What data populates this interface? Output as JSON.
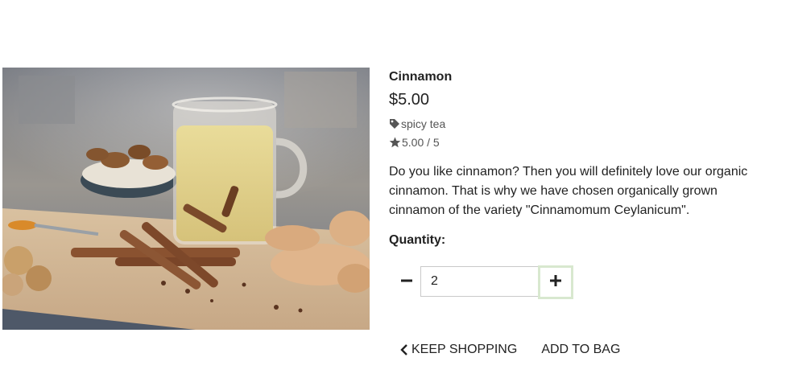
{
  "product": {
    "name": "Cinnamon",
    "price": "$5.00",
    "category": "spicy tea",
    "rating": "5.00 / 5",
    "description": "Do you like cinnamon? Then you will definitely love our organic cinnamon. That is why we have chosen organically grown cinnamon of the variety \"Cinnamomum Ceylanicum\".",
    "image_icon": "cup-of-tea-with-cinnamon-and-ginger-photo"
  },
  "quantity": {
    "label": "Quantity:",
    "value": "2",
    "decrement_icon": "minus-icon",
    "increment_icon": "plus-icon"
  },
  "actions": {
    "keep_shopping": "Keep Shopping",
    "add_to_bag": "Add to Bag"
  },
  "icons": {
    "category": "tag-icon",
    "rating": "star-icon",
    "back": "chevron-left-icon"
  },
  "colors": {
    "plus_border": "#d8e8cf",
    "text": "#222222",
    "muted": "#555555"
  }
}
